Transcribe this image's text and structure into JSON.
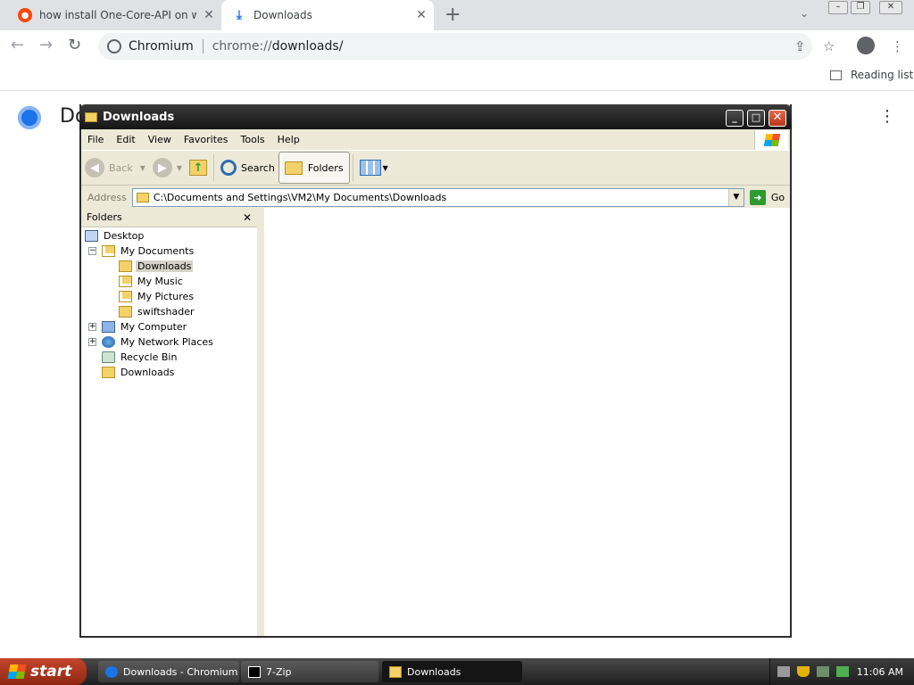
{
  "browser": {
    "tabs": [
      {
        "title": "how install One-Core-API on windo",
        "favicon": "reddit-icon"
      },
      {
        "title": "Downloads",
        "favicon": "download-icon"
      }
    ],
    "omnibox": {
      "site": "Chromium",
      "url_scheme": "chrome://",
      "url_path": "downloads/"
    },
    "reading_list": "Reading list",
    "page_title": "Do"
  },
  "xp_window": {
    "title": "Downloads",
    "menu": [
      "File",
      "Edit",
      "View",
      "Favorites",
      "Tools",
      "Help"
    ],
    "toolbar": {
      "back": "Back",
      "search": "Search",
      "folders": "Folders"
    },
    "address_label": "Address",
    "address": "C:\\Documents and Settings\\VM2\\My Documents\\Downloads",
    "go": "Go",
    "folders_header": "Folders",
    "tree": [
      {
        "label": "Desktop",
        "icon": "desktop-icon"
      },
      {
        "label": "My Documents",
        "icon": "my-documents-icon",
        "expanded": true
      },
      {
        "label": "Downloads",
        "icon": "folder-icon",
        "selected": true
      },
      {
        "label": "My Music",
        "icon": "music-folder-icon"
      },
      {
        "label": "My Pictures",
        "icon": "pictures-folder-icon"
      },
      {
        "label": "swiftshader",
        "icon": "folder-icon"
      },
      {
        "label": "My Computer",
        "icon": "computer-icon",
        "expanded": false
      },
      {
        "label": "My Network Places",
        "icon": "network-icon",
        "expanded": false
      },
      {
        "label": "Recycle Bin",
        "icon": "recycle-bin-icon"
      },
      {
        "label": "Downloads",
        "icon": "folder-icon"
      }
    ]
  },
  "taskbar": {
    "start": "start",
    "buttons": [
      "Downloads - Chromium",
      "7-Zip",
      "Downloads"
    ],
    "clock": "11:06 AM"
  }
}
